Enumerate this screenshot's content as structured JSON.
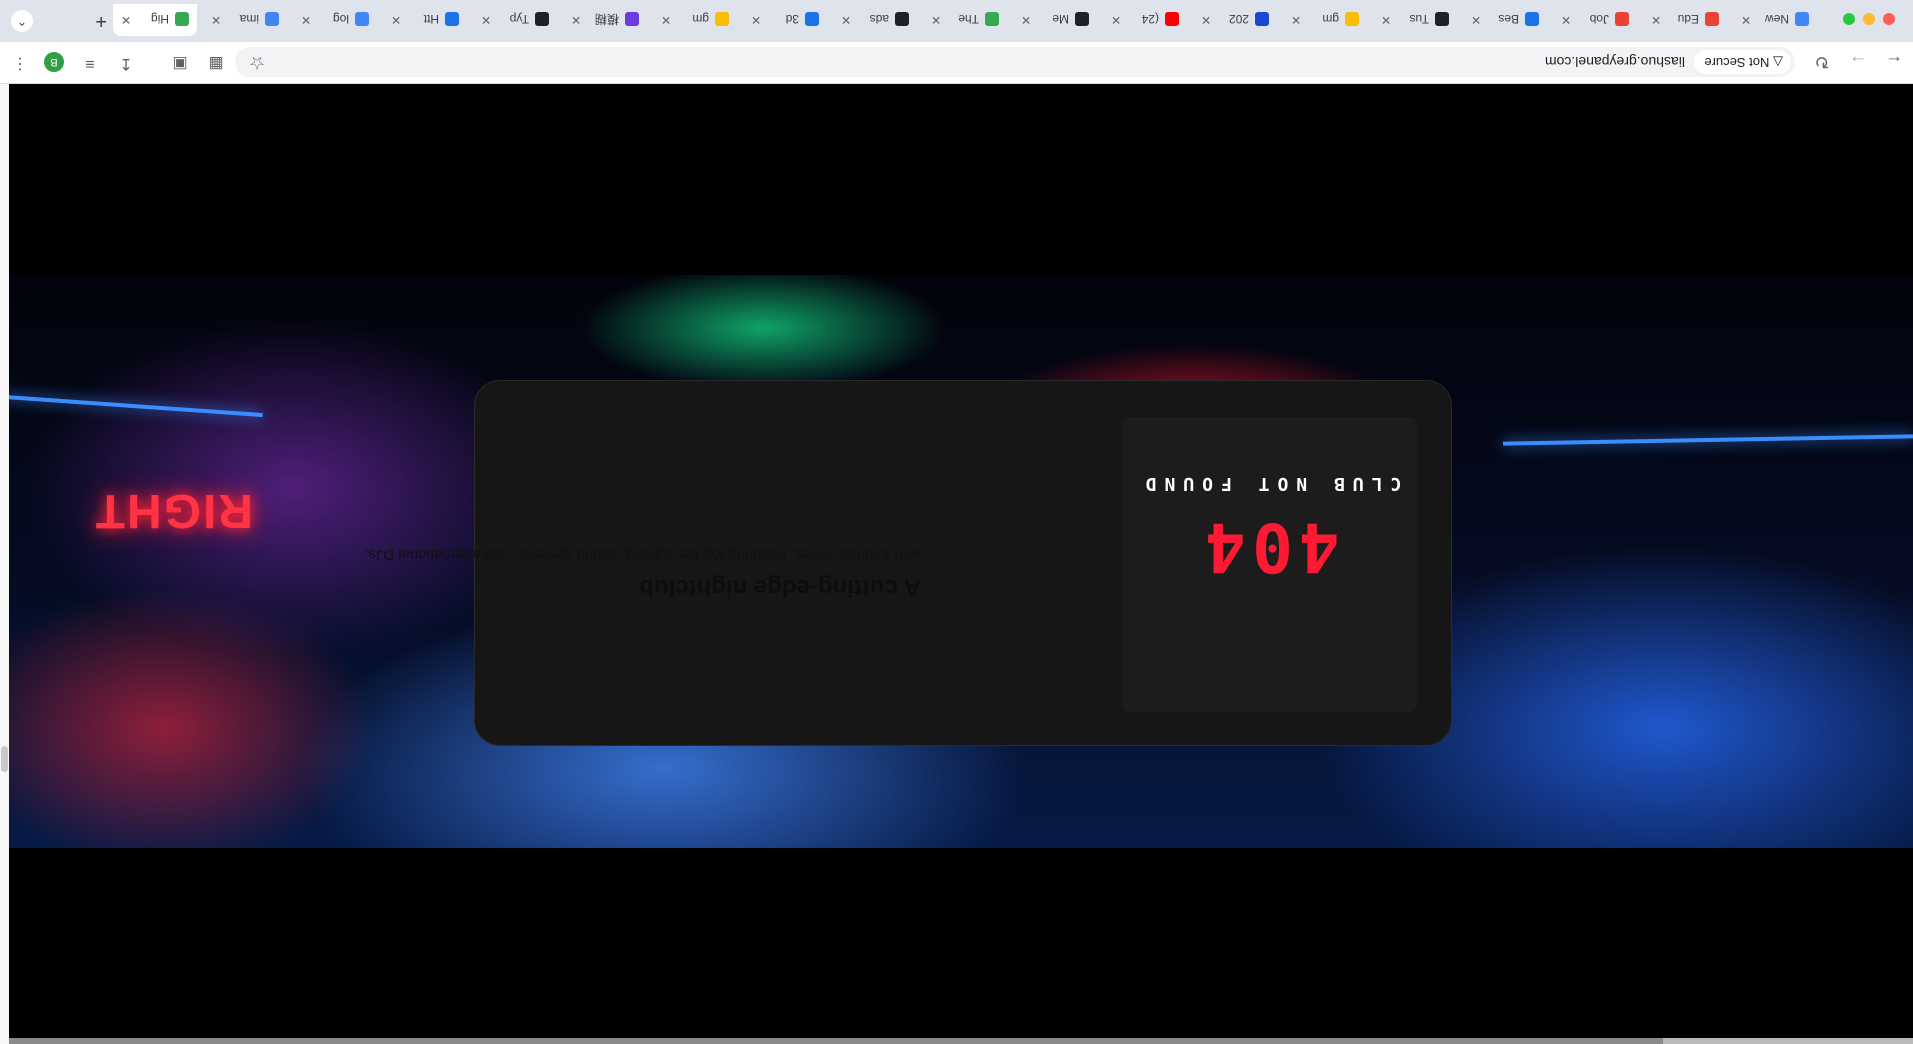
{
  "browser": {
    "security_label": "Not Secure",
    "url": "liashuo.greypanel.com",
    "avatar_letter": "B",
    "new_tab_symbol": "+",
    "tabs": [
      {
        "title": "New",
        "favicon_color": "#4285f4",
        "icon": "globe-icon"
      },
      {
        "title": "Edu",
        "favicon_color": "#ea4335",
        "icon": "edu-icon"
      },
      {
        "title": "Job",
        "favicon_color": "#ea4335",
        "icon": "job-icon"
      },
      {
        "title": "Bes",
        "favicon_color": "#1a73e8",
        "icon": "chart-icon"
      },
      {
        "title": "Tus",
        "favicon_color": "#202124",
        "icon": "dark-icon"
      },
      {
        "title": "gm",
        "favicon_color": "#fbbc04",
        "icon": "smile-icon"
      },
      {
        "title": "202",
        "favicon_color": "#1a47d6",
        "icon": "doc-icon"
      },
      {
        "title": "(24",
        "favicon_color": "#ff0000",
        "icon": "youtube-icon"
      },
      {
        "title": "Me",
        "favicon_color": "#202124",
        "icon": "dark-icon"
      },
      {
        "title": "The",
        "favicon_color": "#34a853",
        "icon": "drive-icon"
      },
      {
        "title": "ads",
        "favicon_color": "#202124",
        "icon": "spinner-icon"
      },
      {
        "title": "3d",
        "favicon_color": "#1a73e8",
        "icon": "globe-icon"
      },
      {
        "title": "gm",
        "favicon_color": "#fbbc04",
        "icon": "smile-icon"
      },
      {
        "title": "模糊",
        "favicon_color": "#6c3be0",
        "icon": "spiral-icon"
      },
      {
        "title": "Typ",
        "favicon_color": "#202124",
        "icon": "gear-icon"
      },
      {
        "title": "Htt",
        "favicon_color": "#1a73e8",
        "icon": "diamond-icon"
      },
      {
        "title": "log",
        "favicon_color": "#4285f4",
        "icon": "google-icon"
      },
      {
        "title": "ima",
        "favicon_color": "#4285f4",
        "icon": "google-icon"
      },
      {
        "title": "Hig",
        "favicon_color": "#34a853",
        "icon": "tree-icon",
        "active": true
      }
    ]
  },
  "page": {
    "logo_text": "404",
    "logo_subtitle": "CLUB NOT FOUND",
    "title": "A cutting-edge nightclub",
    "description": "with futuristic vibes, featuring top-tier lighting, sound systems, and international DJs.",
    "neon_sign": "RIGHT"
  },
  "colors": {
    "accent_red": "#ff1a33",
    "card_bg": "#161616",
    "page_bg": "#000000"
  }
}
